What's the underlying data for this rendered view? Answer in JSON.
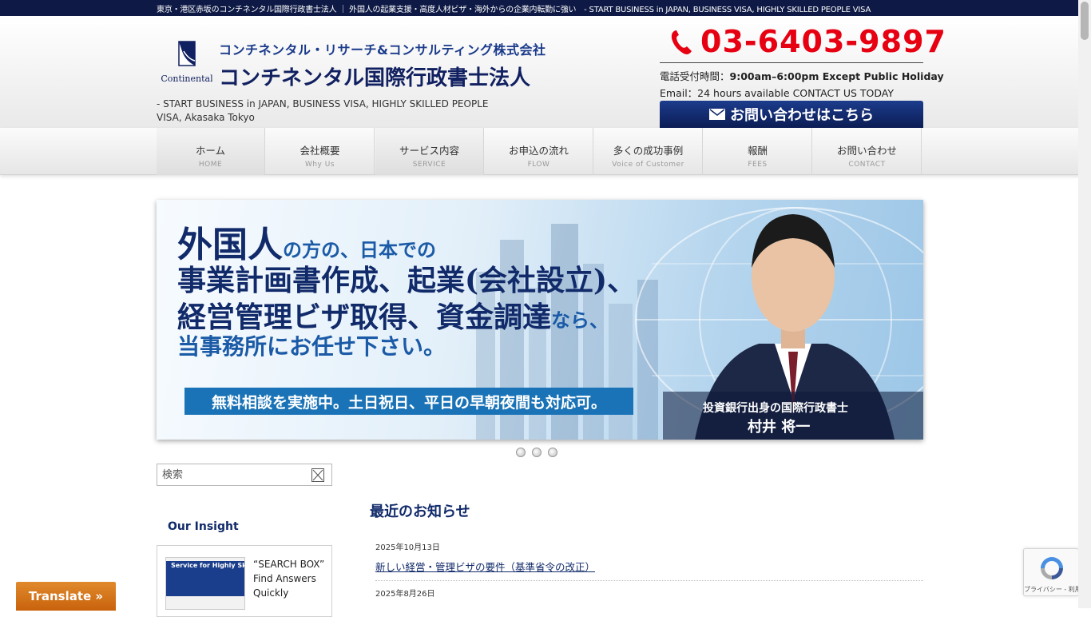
{
  "topbar": {
    "text": "東京・港区赤坂のコンチネンタル国際行政書士法人 ｜ 外国人の起業支援・高度人材ビザ・海外からの企業内転勤に強い　- START BUSINESS in JAPAN, BUSINESS VISA, HIGHLY SKILLED PEOPLE VISA"
  },
  "header": {
    "logo_text": "Continental",
    "company_line1": "コンチネンタル・リサーチ&コンサルティング株式会社",
    "company_line2": "コンチネンタル国際行政書士法人",
    "tagline": "- START BUSINESS in JAPAN, BUSINESS VISA, HIGHLY SKILLED PEOPLE VISA, Akasaka Tokyo",
    "phone": "03-6403-9897",
    "hours_label": "電話受付時間：",
    "hours_value": "9:00am–6:00pm Except Public Holiday",
    "email_line": "Email：24 hours available CONTACT US TODAY",
    "contact_button": "お問い合わせはこちら"
  },
  "nav": {
    "items": [
      {
        "jp": "ホーム",
        "en": "HOME"
      },
      {
        "jp": "会社概要",
        "en": "Why Us"
      },
      {
        "jp": "サービス内容",
        "en": "SERVICE"
      },
      {
        "jp": "お申込の流れ",
        "en": "FLOW"
      },
      {
        "jp": "多くの成功事例",
        "en": "Voice of Customer"
      },
      {
        "jp": "報酬",
        "en": "FEES"
      },
      {
        "jp": "お問い合わせ",
        "en": "CONTACT"
      }
    ]
  },
  "hero": {
    "line1_big": "外国人",
    "line1_small": "の方の、日本での",
    "line2": "事業計画書作成、起業(会社設立)、",
    "line3_big": "経営管理ビザ取得、資金調達",
    "line3_small": "なら、",
    "line4": "当事務所にお任せ下さい。",
    "band": "無料相談を実施中。土日祝日、平日の早朝夜間も対応可。",
    "caption_title": "投資銀行出身の国際行政書士",
    "caption_name": "村井 将一"
  },
  "search": {
    "placeholder": "検索"
  },
  "sidebar": {
    "insight_title": "Our Insight",
    "insight_thumb_text": "Service for Highly Skilled People",
    "insight_text": "“SEARCH BOX” Find Answers Quickly"
  },
  "news": {
    "title": "最近のお知らせ",
    "items": [
      {
        "date": "2025年10月13日",
        "title": "新しい経営・管理ビザの要件（基準省令の改正）"
      },
      {
        "date": "2025年8月26日",
        "title": ""
      }
    ]
  },
  "translate": {
    "label": "Translate »"
  },
  "recaptcha": {
    "text": "プライバシー - 利用規約"
  },
  "colors": {
    "navy": "#0e1a45",
    "brand_blue": "#112a6a",
    "phone_red": "#e60012",
    "translate_orange": "#d8781c"
  }
}
